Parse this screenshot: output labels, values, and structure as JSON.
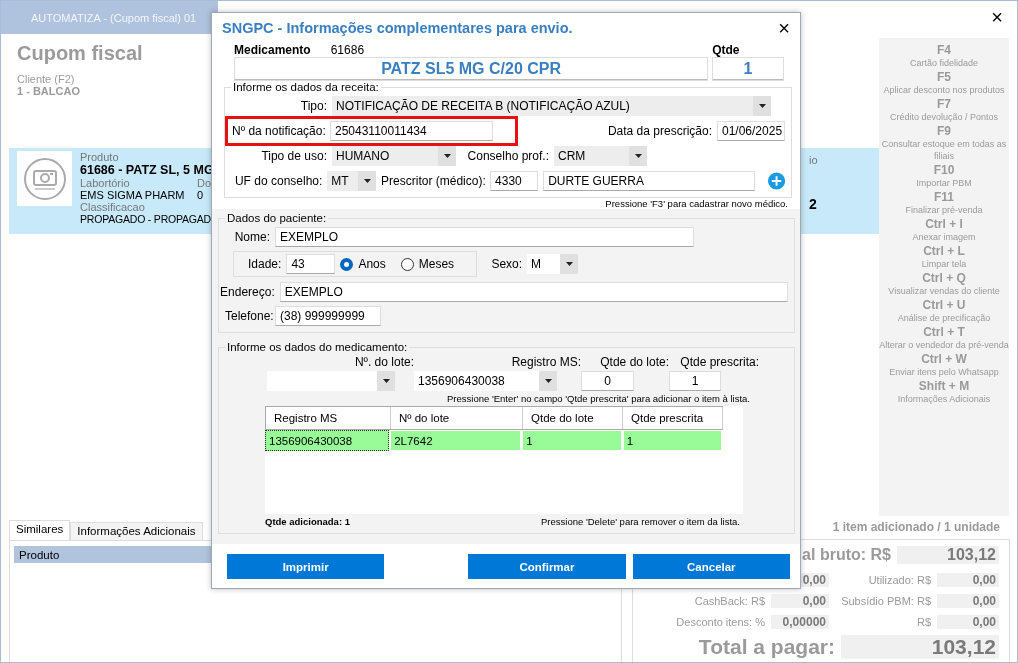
{
  "window": {
    "title": "AUTOMATIZA - (Cupom fiscal) 01",
    "close": "×"
  },
  "header": {
    "title": "Cupom fiscal",
    "client_label": "Cliente (F2)",
    "client": "1 - BALCAO"
  },
  "product": {
    "label": "Produto",
    "name": "61686 - PATZ SL, 5 MG",
    "lab_label": "Labortório",
    "lab": "EMS SIGMA PHARM",
    "column_2_label": "Do",
    "column_2": "0",
    "class_label": "Classificacao",
    "class": "PROPAGADO - PROPAGAD",
    "column_3_label": "io",
    "column_3": "2"
  },
  "shortcuts": [
    {
      "key": "F4",
      "action": "Cartão fidelidade"
    },
    {
      "key": "F5",
      "action": "Aplicar desconto nos produtos"
    },
    {
      "key": "F7",
      "action": "Crédito devolução / Pontos"
    },
    {
      "key": "F9",
      "action": "Consultar estoque em todas as filiais"
    },
    {
      "key": "F10",
      "action": "Importar PBM"
    },
    {
      "key": "F11",
      "action": "Finalizar pré-venda"
    },
    {
      "key": "Ctrl + I",
      "action": "Anexar imagem"
    },
    {
      "key": "Ctrl + L",
      "action": "Limpar tela"
    },
    {
      "key": "Ctrl + Q",
      "action": "Visualizar vendas do cliente"
    },
    {
      "key": "Ctrl + U",
      "action": "Análise de precificação"
    },
    {
      "key": "Ctrl + T",
      "action": "Alterar o vendedor da pré-venda"
    },
    {
      "key": "Ctrl + W",
      "action": "Enviar itens pelo Whatsapp"
    },
    {
      "key": "Shift + M",
      "action": "Informações Adicionais"
    }
  ],
  "bottom_tabs": [
    {
      "label": "Similares",
      "selected": true
    },
    {
      "label": "Informações Adicionais",
      "selected": false
    }
  ],
  "similares_table": {
    "columns": [
      "Produto"
    ]
  },
  "summary": "1 item adicionado / 1 unidade",
  "totals": [
    {
      "kind": "gross",
      "label": "al bruto: R$",
      "value": "103,12"
    },
    {
      "kind": "pair",
      "value": "0,00",
      "label2": "Utilizado: R$",
      "value2": "0,00"
    },
    {
      "kind": "pair",
      "label": "CashBack: R$",
      "value": "0,00",
      "label2": "Subsídio PBM: R$",
      "value2": "0,00"
    },
    {
      "kind": "pair",
      "label": "Desconto itens: %",
      "value": "0,00000",
      "label2": "R$",
      "value2": "0,00"
    },
    {
      "kind": "total",
      "label": "Total a pagar:",
      "value": "103,12"
    }
  ],
  "dialog": {
    "title": "SNGPC - Informações complementares para envio.",
    "close": "×",
    "medicine_label": "Medicamento",
    "medicine_code": "61686",
    "medicine_name": "PATZ SL5 MG C/20 CPR",
    "qty_label": "Qtde",
    "qty": "1",
    "prescription": {
      "legend": "Informe os dados da receita:",
      "type_label": "Tipo:",
      "type": "NOTIFICAÇÃO DE RECEITA B (NOTIFICAÇÃO AZUL)",
      "number_label": "Nº da notificação:",
      "number": "25043110011434",
      "number_highlighted": true,
      "date_label": "Data da prescrição:",
      "date": "01/06/2025",
      "use_label": "Tipo de uso:",
      "use": "HUMANO",
      "council_label": "Conselho prof.:",
      "council": "CRM",
      "uf_label": "UF do conselho:",
      "uf": "MT",
      "prescriber_label": "Prescritor (médico):",
      "prescriber_code": "4330",
      "prescriber_name": "DURTE GUERRA"
    },
    "f3_hint": "Pressione 'F3' para cadastrar novo médico.",
    "patient": {
      "legend": "Dados do paciente:",
      "name_label": "Nome:",
      "name": "EXEMPLO",
      "age_label": "Idade:",
      "age": "43",
      "age_units": [
        {
          "label": "Anos",
          "selected": true
        },
        {
          "label": "Meses",
          "selected": false
        }
      ],
      "sex_label": "Sexo:",
      "sex": "M",
      "address_label": "Endereço:",
      "address": "EXEMPLO",
      "phone_label": "Telefone:",
      "phone": "(38) 999999999"
    },
    "medicine": {
      "legend": "Informe os dados do medicamento:",
      "lot_label": "Nº. do lote:",
      "ms_label": "Registro MS:",
      "ms": "1356906430038",
      "lot_qty_label": "Qtde do lote:",
      "lot_qty": "0",
      "prescribed_label": "Qtde prescrita:",
      "prescribed": "1",
      "enter_hint": "Pressione 'Enter' no campo 'Qtde prescrita' para adicionar o item à lista.",
      "table": {
        "columns": [
          "Registro MS",
          "Nº do lote",
          "Qtde do lote",
          "Qtde prescrita"
        ],
        "rows": [
          {
            "cells": [
              "1356906430038",
              "2L7642",
              "1",
              "1"
            ],
            "selected": true
          }
        ]
      },
      "added": "Qtde adicionada: 1",
      "delete_hint": "Pressione 'Delete' para remover o item da lista."
    },
    "buttons": [
      "Imprimir",
      "Confirmar",
      "Cancelar"
    ]
  }
}
